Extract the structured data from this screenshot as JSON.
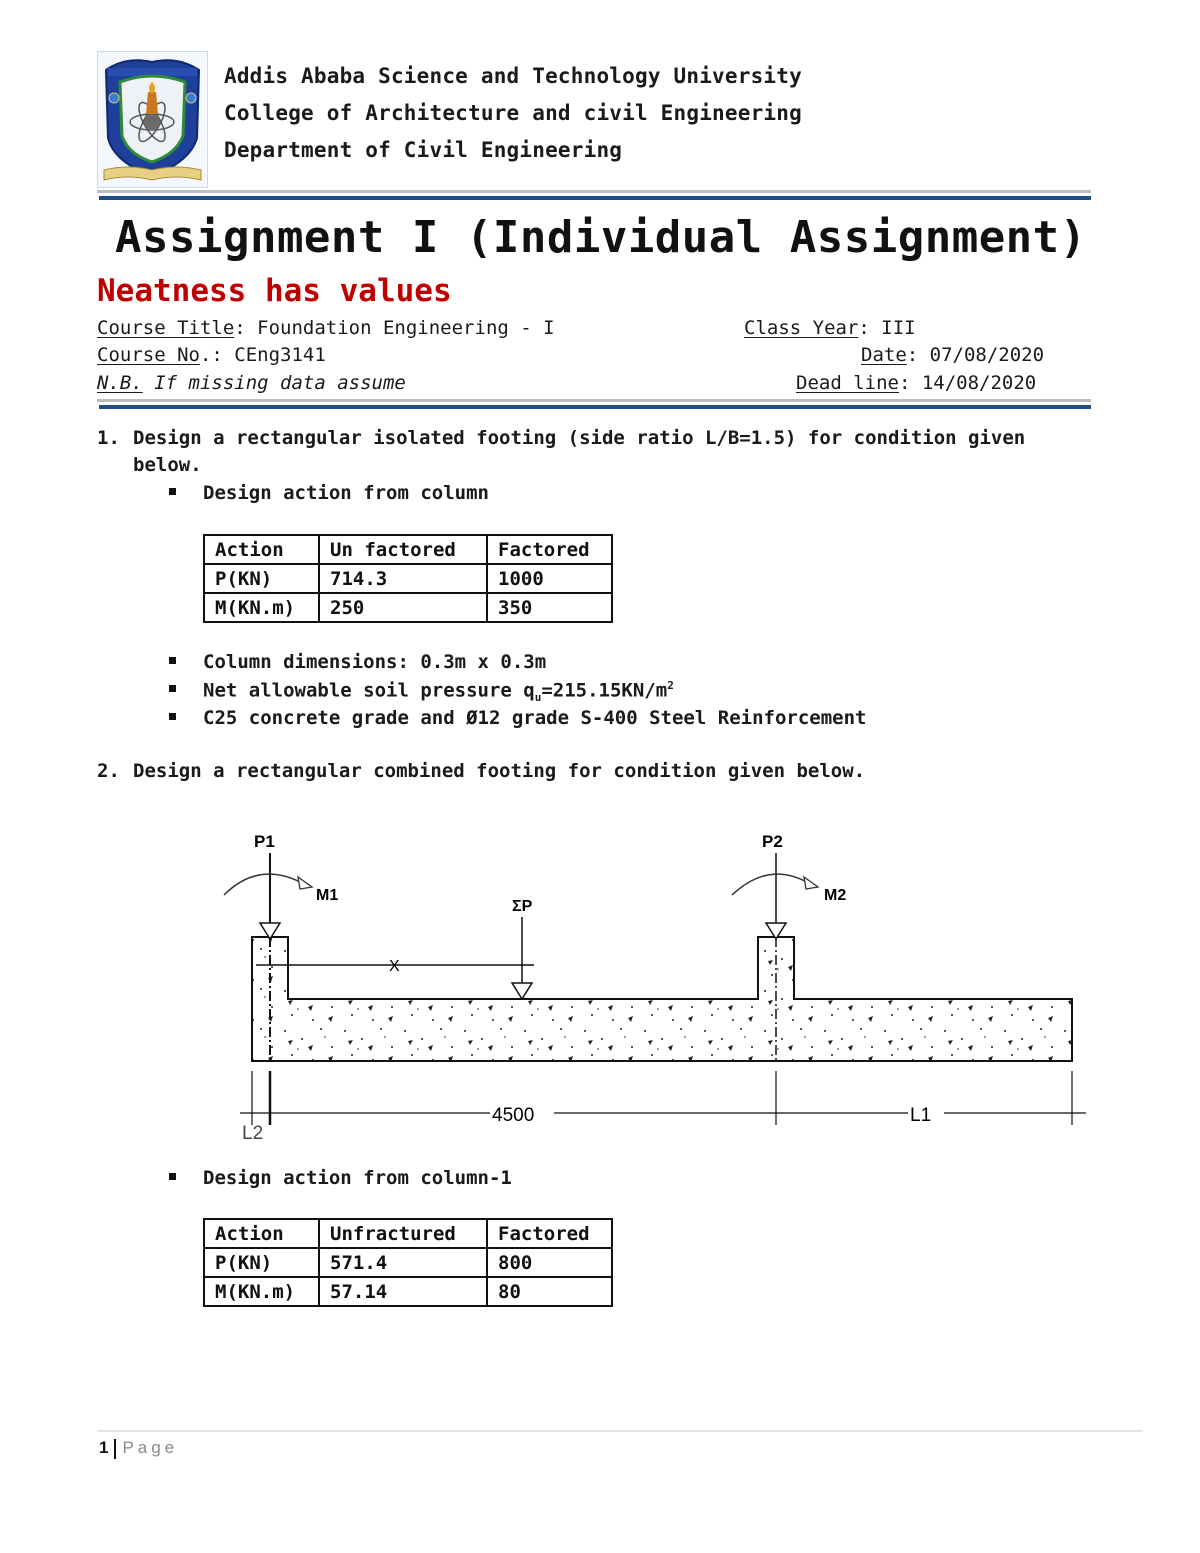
{
  "header": {
    "university": "Addis Ababa Science and Technology University",
    "college": "College of Architecture and civil Engineering",
    "department": "Department of Civil Engineering",
    "logo_icon": "university-crest-icon",
    "colors": {
      "rule_blue": "#1f4e87",
      "rule_grey": "#bdbdbd",
      "subtitle_red": "#c00000"
    }
  },
  "title": "Assignment I (Individual Assignment)",
  "subtitle": "Neatness has values",
  "meta": {
    "course_title_label": "Course Title",
    "course_title_value": ": Foundation Engineering - I",
    "class_year_label": "Class Year",
    "class_year_value": ": III",
    "course_no_label": "Course No",
    "course_no_value": ".: CEng3141",
    "date_label": "Date",
    "date_value": ": 07/08/2020",
    "nb_label": "N.B.",
    "nb_value": " If missing data assume",
    "deadline_label": "Dead line",
    "deadline_value": ": 14/08/2020"
  },
  "question1": {
    "number": "1.",
    "text_line1": "Design a rectangular isolated footing (side ratio L/B=1.5) for condition given",
    "text_line2": "below.",
    "bullet_design_action": "Design action from column",
    "table": {
      "headers": [
        "Action",
        "Un factored",
        "Factored"
      ],
      "rows": [
        [
          "P(KN)",
          "714.3",
          "1000"
        ],
        [
          "M(KN.m)",
          "250",
          "350"
        ]
      ]
    },
    "bullets": [
      "Column dimensions: 0.3m x 0.3m",
      "Net allowable soil pressure q",
      "C25 concrete grade and Ø12 grade S-400 Steel Reinforcement"
    ],
    "soil_pressure_sub": "u",
    "soil_pressure_rest": "=215.15KN/m",
    "soil_pressure_sup": "2"
  },
  "question2": {
    "number": "2.",
    "text": "Design a rectangular combined footing for condition given below.",
    "diagram": {
      "p1_label": "P1",
      "p2_label": "P2",
      "m1_label": "M1",
      "m2_label": "M2",
      "resultant_label": "ΣP",
      "x_label": "X",
      "dim_span": "4500",
      "dim_l1": "L1",
      "dim_l2": "L2"
    },
    "bullet_design_action": "Design action from column-1",
    "table": {
      "headers": [
        "Action",
        "Unfractured",
        "Factored"
      ],
      "rows": [
        [
          "P(KN)",
          "571.4",
          "800"
        ],
        [
          "M(KN.m)",
          "57.14",
          "80"
        ]
      ]
    }
  },
  "footer": {
    "page_number": "1",
    "page_label": "Page"
  }
}
